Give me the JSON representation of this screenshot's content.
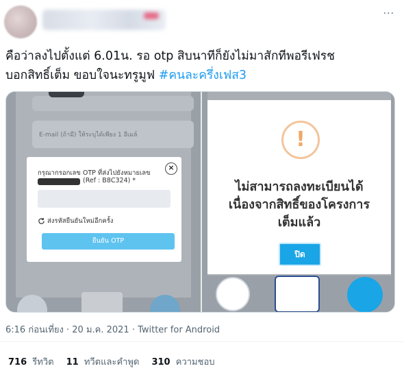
{
  "tweet": {
    "more_label": "···",
    "text_line1": "คือว่าลงไปตั้งแต่ 6.01น. รอ otp สิบนาทีก็ยังไม่มาสักทีพอรีเฟรช",
    "text_line2": "บอกสิทธิ์เต็ม ขอบใจนะทรูมูฟ",
    "hashtag": "#คนละครึ่งเฟส3",
    "timestamp": "6:16 ก่อนเที่ยง · 20 ม.ค. 2021 · Twitter for Android"
  },
  "left_screen": {
    "email_placeholder": "E-mail (ถ้ามี) ให้ระบุได้เพียง 1 อีเมล์",
    "otp_title": "กรุณากรอกเลข OTP ที่ส่งไปยังหมายเลข",
    "otp_ref": "(Ref : B8C324)  *",
    "resend_label": "ส่งรหัสยืนยันใหม่อีกครั้ง",
    "confirm_label": "ยืนยัน OTP",
    "close_label": "×"
  },
  "right_screen": {
    "alert_icon": "!",
    "message_line1": "ไม่สามารถลงทะเบียนได้",
    "message_line2": "เนื่องจากสิทธิ์ของโครงการ",
    "message_line3": "เต็มแล้ว",
    "ok_label": "ปิด"
  },
  "stats": {
    "retweets_count": "716",
    "retweets_label": "รีทวิต",
    "quotes_count": "11",
    "quotes_label": "ทวีตและคำพูด",
    "likes_count": "310",
    "likes_label": "ความชอบ"
  },
  "colors": {
    "link": "#1d9bf0",
    "confirm_button": "#5fc3f0",
    "ok_button": "#1aa5e6",
    "warning": "#f0a867"
  }
}
